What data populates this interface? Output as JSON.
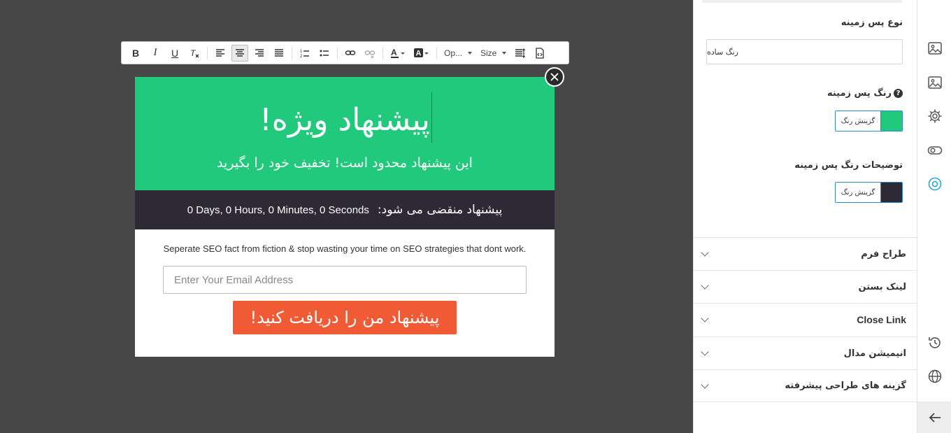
{
  "toolbar": {
    "font_label": "Op...",
    "size_label": "Size"
  },
  "popup": {
    "title": "پیشنهاد ویژه!",
    "subtitle": "این پیشنهاد محدود است! تخفیف خود را بگیرید",
    "countdown_label": "پیشنهاد منقضی می شود:",
    "countdown_time": "0 Days, 0 Hours, 0 Minutes, 0 Seconds",
    "tagline": "Seperate SEO fact from fiction & stop wasting your time on SEO strategies that dont work.",
    "email_placeholder": "Enter Your Email Address",
    "cta_label": "پیشنهاد من را دریافت کنید!",
    "colors": {
      "hero": "#20c97b",
      "countdown": "#2d2a35",
      "cta": "#f05a35"
    }
  },
  "panel": {
    "bg_type_label": "نوع پس زمینه",
    "bg_type_value": "رنگ ساده",
    "bg_color_label": "رنگ پس زمینه",
    "bg_color_help": "?",
    "bg_color_button": "گزینش رنگ",
    "bg_color_value": "#20c97b",
    "desc_color_label": "توضیحات رنگ پس زمینه",
    "desc_color_button": "گزینش رنگ",
    "desc_color_value": "#2d2a35",
    "sections": [
      {
        "label": "طراح فرم"
      },
      {
        "label": "لینک بستن"
      },
      {
        "label": "Close Link"
      },
      {
        "label": "انیمیشن مدال"
      },
      {
        "label": "گزینه های طراحی پیشرفته"
      }
    ]
  },
  "rail": {
    "icons": [
      "image-icon",
      "image-icon",
      "gear-icon",
      "toggle-icon",
      "target-icon",
      "history-icon",
      "globe-icon",
      "arrow-left-icon"
    ]
  }
}
